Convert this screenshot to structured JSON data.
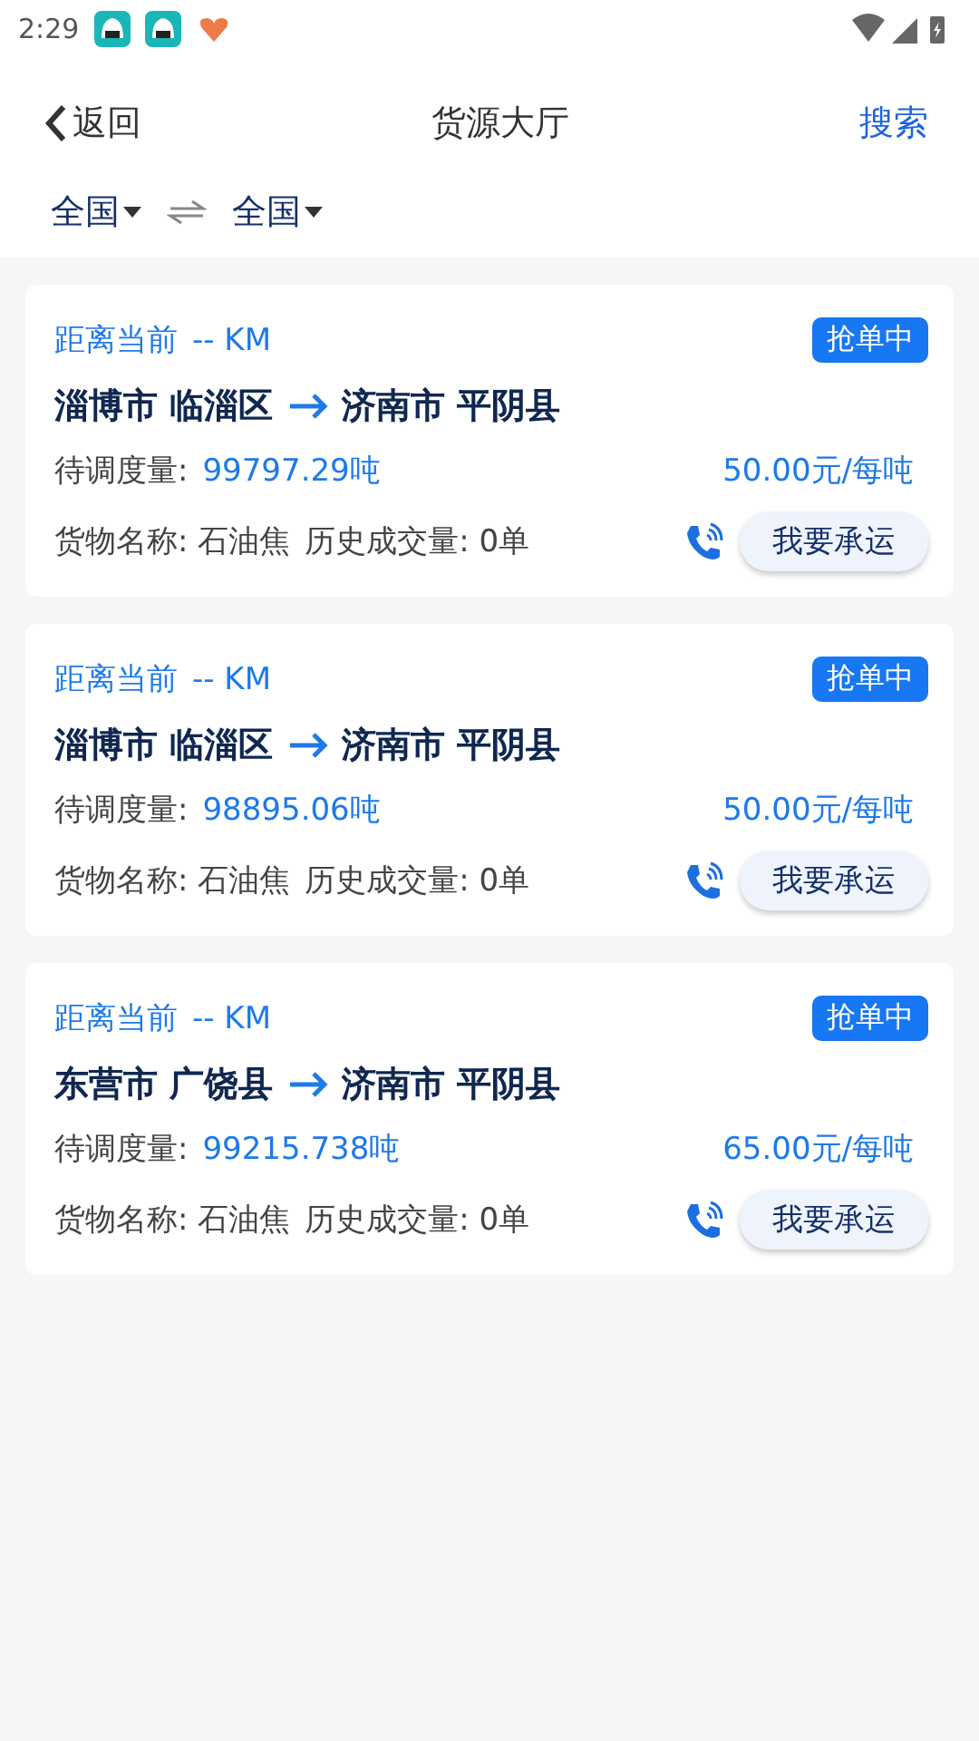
{
  "status_bar": {
    "time": "2:29"
  },
  "nav": {
    "back": "返回",
    "title": "货源大厅",
    "action": "搜索"
  },
  "filter": {
    "from": "全国",
    "to": "全国"
  },
  "orders": [
    {
      "distance_label": "距离当前",
      "distance": "-- KM",
      "status": "抢单中",
      "origin": "淄博市 临淄区",
      "destination": "济南市 平阴县",
      "quantity_label": "待调度量:",
      "quantity": "99797.29吨",
      "price": "50.00元/每吨",
      "cargo": "货物名称: 石油焦",
      "history": "历史成交量: 0单",
      "action": "我要承运"
    },
    {
      "distance_label": "距离当前",
      "distance": "-- KM",
      "status": "抢单中",
      "origin": "淄博市 临淄区",
      "destination": "济南市 平阴县",
      "quantity_label": "待调度量:",
      "quantity": "98895.06吨",
      "price": "50.00元/每吨",
      "cargo": "货物名称: 石油焦",
      "history": "历史成交量: 0单",
      "action": "我要承运"
    },
    {
      "distance_label": "距离当前",
      "distance": "-- KM",
      "status": "抢单中",
      "origin": "东营市 广饶县",
      "destination": "济南市 平阴县",
      "quantity_label": "待调度量:",
      "quantity": "99215.738吨",
      "price": "65.00元/每吨",
      "cargo": "货物名称: 石油焦",
      "history": "历史成交量: 0单",
      "action": "我要承运"
    }
  ]
}
